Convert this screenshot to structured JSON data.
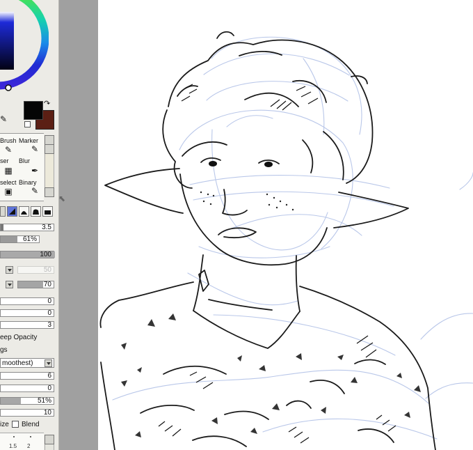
{
  "tools": [
    {
      "label": "Brush",
      "icon": "✎"
    },
    {
      "label": "Marker",
      "icon": "✎"
    },
    {
      "label": "ser",
      "icon": "▦"
    },
    {
      "label": "Blur",
      "icon": "✒"
    },
    {
      "label": "select",
      "icon": "▣"
    },
    {
      "label": "Binary",
      "icon": "✎"
    }
  ],
  "brush": {
    "size": "3.5",
    "min_size": "61%",
    "density": "100",
    "value_a": "50",
    "value_b": "70",
    "zero_1": "0",
    "zero_2": "0",
    "three": "3",
    "keep_opacity": "eep Opacity",
    "settings_label": "gs",
    "smoothing": "moothest)",
    "six": "6",
    "zero_3": "0",
    "percent": "51%",
    "ten": "10"
  },
  "labels": {
    "ize": "ize",
    "blend": "Blend"
  },
  "colors": {
    "foreground": "#050505",
    "background": "#5b1f14",
    "accent": "#5f74d9"
  },
  "icons": {
    "swap": "swap-icon",
    "eyedropper": "eyedropper-icon",
    "scroll-up": "scroll-up-icon",
    "scroll-down": "scroll-down-icon"
  }
}
